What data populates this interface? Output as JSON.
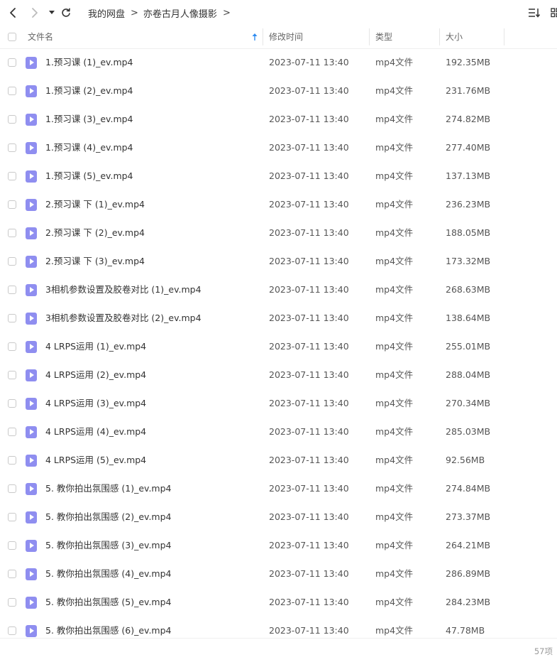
{
  "breadcrumb": [
    "我的网盘",
    "亦卷古月人像摄影"
  ],
  "columns": {
    "name": "文件名",
    "modified": "修改时间",
    "type": "类型",
    "size": "大小"
  },
  "files": [
    {
      "name": "1.预习课 (1)_ev.mp4",
      "modified": "2023-07-11 13:40",
      "type": "mp4文件",
      "size": "192.35MB"
    },
    {
      "name": "1.预习课 (2)_ev.mp4",
      "modified": "2023-07-11 13:40",
      "type": "mp4文件",
      "size": "231.76MB"
    },
    {
      "name": "1.预习课 (3)_ev.mp4",
      "modified": "2023-07-11 13:40",
      "type": "mp4文件",
      "size": "274.82MB"
    },
    {
      "name": "1.预习课 (4)_ev.mp4",
      "modified": "2023-07-11 13:40",
      "type": "mp4文件",
      "size": "277.40MB"
    },
    {
      "name": "1.预习课 (5)_ev.mp4",
      "modified": "2023-07-11 13:40",
      "type": "mp4文件",
      "size": "137.13MB"
    },
    {
      "name": "2.预习课 下 (1)_ev.mp4",
      "modified": "2023-07-11 13:40",
      "type": "mp4文件",
      "size": "236.23MB"
    },
    {
      "name": "2.预习课 下 (2)_ev.mp4",
      "modified": "2023-07-11 13:40",
      "type": "mp4文件",
      "size": "188.05MB"
    },
    {
      "name": "2.预习课 下 (3)_ev.mp4",
      "modified": "2023-07-11 13:40",
      "type": "mp4文件",
      "size": "173.32MB"
    },
    {
      "name": "3相机参数设置及胶卷对比 (1)_ev.mp4",
      "modified": "2023-07-11 13:40",
      "type": "mp4文件",
      "size": "268.63MB"
    },
    {
      "name": "3相机参数设置及胶卷对比 (2)_ev.mp4",
      "modified": "2023-07-11 13:40",
      "type": "mp4文件",
      "size": "138.64MB"
    },
    {
      "name": "4 LRPS运用  (1)_ev.mp4",
      "modified": "2023-07-11 13:40",
      "type": "mp4文件",
      "size": "255.01MB"
    },
    {
      "name": "4 LRPS运用  (2)_ev.mp4",
      "modified": "2023-07-11 13:40",
      "type": "mp4文件",
      "size": "288.04MB"
    },
    {
      "name": "4 LRPS运用  (3)_ev.mp4",
      "modified": "2023-07-11 13:40",
      "type": "mp4文件",
      "size": "270.34MB"
    },
    {
      "name": "4 LRPS运用  (4)_ev.mp4",
      "modified": "2023-07-11 13:40",
      "type": "mp4文件",
      "size": "285.03MB"
    },
    {
      "name": "4 LRPS运用  (5)_ev.mp4",
      "modified": "2023-07-11 13:40",
      "type": "mp4文件",
      "size": "92.56MB"
    },
    {
      "name": "5.  教你拍出氛围感 (1)_ev.mp4",
      "modified": "2023-07-11 13:40",
      "type": "mp4文件",
      "size": "274.84MB"
    },
    {
      "name": "5.  教你拍出氛围感 (2)_ev.mp4",
      "modified": "2023-07-11 13:40",
      "type": "mp4文件",
      "size": "273.37MB"
    },
    {
      "name": "5.  教你拍出氛围感 (3)_ev.mp4",
      "modified": "2023-07-11 13:40",
      "type": "mp4文件",
      "size": "264.21MB"
    },
    {
      "name": "5.  教你拍出氛围感 (4)_ev.mp4",
      "modified": "2023-07-11 13:40",
      "type": "mp4文件",
      "size": "286.89MB"
    },
    {
      "name": "5.  教你拍出氛围感 (5)_ev.mp4",
      "modified": "2023-07-11 13:40",
      "type": "mp4文件",
      "size": "284.23MB"
    },
    {
      "name": "5.  教你拍出氛围感 (6)_ev.mp4",
      "modified": "2023-07-11 13:40",
      "type": "mp4文件",
      "size": "47.78MB"
    }
  ],
  "footer": {
    "count": "57项"
  },
  "icons": {
    "file": "video-file-icon",
    "accent": "#8f8ef0",
    "sort_accent": "#2f8cf0"
  }
}
